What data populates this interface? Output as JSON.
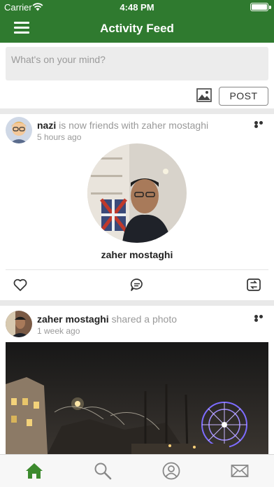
{
  "status_bar": {
    "carrier": "Carrier",
    "time": "4:48 PM"
  },
  "header": {
    "title": "Activity Feed",
    "menu_icon": "hamburger-menu-icon"
  },
  "composer": {
    "placeholder": "What's on your mind?",
    "post_label": "POST",
    "photo_icon": "image-icon"
  },
  "feed": [
    {
      "actor": "nazi",
      "action": "is now friends with zaher mostaghi",
      "time": "5 hours ago",
      "friend_name": "zaher mostaghi",
      "actions": [
        "heart-icon",
        "comment-icon",
        "repost-icon"
      ]
    },
    {
      "actor": "zaher mostaghi",
      "action": "shared a photo",
      "time": "1 week ago"
    }
  ],
  "tabs": [
    {
      "icon": "home-icon",
      "active": true
    },
    {
      "icon": "search-icon",
      "active": false
    },
    {
      "icon": "profile-icon",
      "active": false
    },
    {
      "icon": "mail-icon",
      "active": false
    }
  ],
  "colors": {
    "brand": "#2f7a2f",
    "tab_active": "#3c8a2e",
    "tab_inactive": "#888888"
  }
}
